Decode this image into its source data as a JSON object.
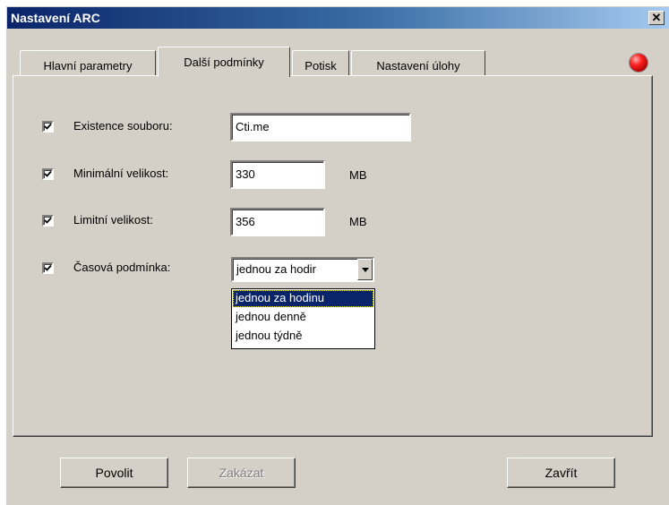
{
  "window": {
    "title": "Nastavení ARC",
    "close_glyph": "✕"
  },
  "tabs": [
    {
      "label": "Hlavní parametry",
      "active": false
    },
    {
      "label": "Další podmínky",
      "active": true
    },
    {
      "label": "Potisk",
      "active": false
    },
    {
      "label": "Nastavení úlohy",
      "active": false
    }
  ],
  "status_led": {
    "icon": "red-led-icon",
    "color": "#ff2020"
  },
  "conditions": {
    "file_exists": {
      "checked": true,
      "label": "Existence souboru:",
      "value": "Cti.me"
    },
    "min_size": {
      "checked": true,
      "label": "Minimální velikost:",
      "value": "330",
      "unit": "MB"
    },
    "limit_size": {
      "checked": true,
      "label": "Limitní velikost:",
      "value": "356",
      "unit": "MB"
    },
    "time_condition": {
      "checked": true,
      "label": "Časová podmínka:",
      "selected": "jednou za hodir",
      "options": [
        "jednou za hodinu",
        "jednou denně",
        "jednou týdně"
      ]
    }
  },
  "buttons": {
    "enable": "Povolit",
    "disable": "Zakázat",
    "close": "Zavřít"
  }
}
